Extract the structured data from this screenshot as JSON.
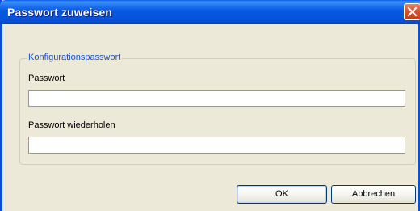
{
  "window": {
    "title": "Passwort zuweisen",
    "accent_color": "#0A4FD5",
    "close_icon": "close-icon"
  },
  "group": {
    "legend": "Konfigurationspasswort",
    "password_label": "Passwort",
    "password_value": "",
    "repeat_label": "Passwort wiederholen",
    "repeat_value": ""
  },
  "buttons": {
    "ok_label": "OK",
    "cancel_label": "Abbrechen"
  }
}
